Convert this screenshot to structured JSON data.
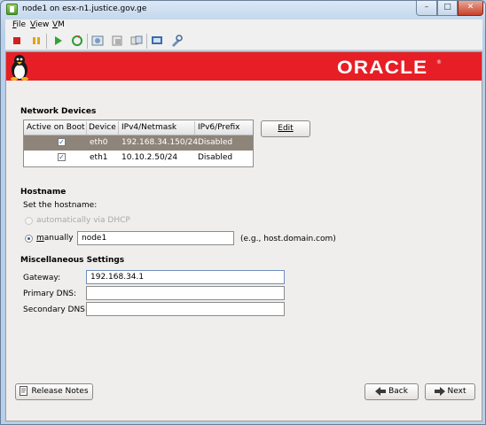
{
  "window": {
    "title": "node1 on esx-n1.justice.gov.ge",
    "min": "–",
    "max": "□",
    "close": "✕"
  },
  "menu": {
    "file": "F",
    "file_rest": "ile",
    "view": "V",
    "view_rest": "iew",
    "vm": "V",
    "vm_rest": "M"
  },
  "toolbar_icons": [
    "power-off-icon",
    "pause-icon",
    "power-on-icon",
    "reset-icon",
    "snapshot-icon",
    "revert-snapshot-icon",
    "snapshot-manager-icon",
    "console-icon",
    "settings-icon"
  ],
  "brand": {
    "logo": "ORACLE",
    "mark": "®"
  },
  "network": {
    "heading": "Network Devices",
    "columns": [
      "Active on Boot",
      "Device",
      "IPv4/Netmask",
      "IPv6/Prefix"
    ],
    "rows": [
      {
        "active": true,
        "device": "eth0",
        "ipv4": "192.168.34.150/24",
        "ipv6": "Disabled",
        "selected": true
      },
      {
        "active": true,
        "device": "eth1",
        "ipv4": "10.10.2.50/24",
        "ipv6": "Disabled",
        "selected": false
      }
    ],
    "edit": "Edit"
  },
  "hostname": {
    "heading": "Hostname",
    "prompt": "Set the hostname:",
    "dhcp": "automatically via DHCP",
    "manual_u": "m",
    "manual_rest": "anually",
    "value": "node1",
    "example": "(e.g., host.domain.com)"
  },
  "misc": {
    "heading": "Miscellaneous Settings",
    "gateway_label": "Gateway:",
    "gateway": "192.168.34.1",
    "primary_dns_label": "Primary DNS:",
    "primary_dns": "",
    "secondary_dns_label": "Secondary DNS:",
    "secondary_dns": ""
  },
  "footer": {
    "release_notes": "Release Notes",
    "back": "Back",
    "next": "Next"
  }
}
